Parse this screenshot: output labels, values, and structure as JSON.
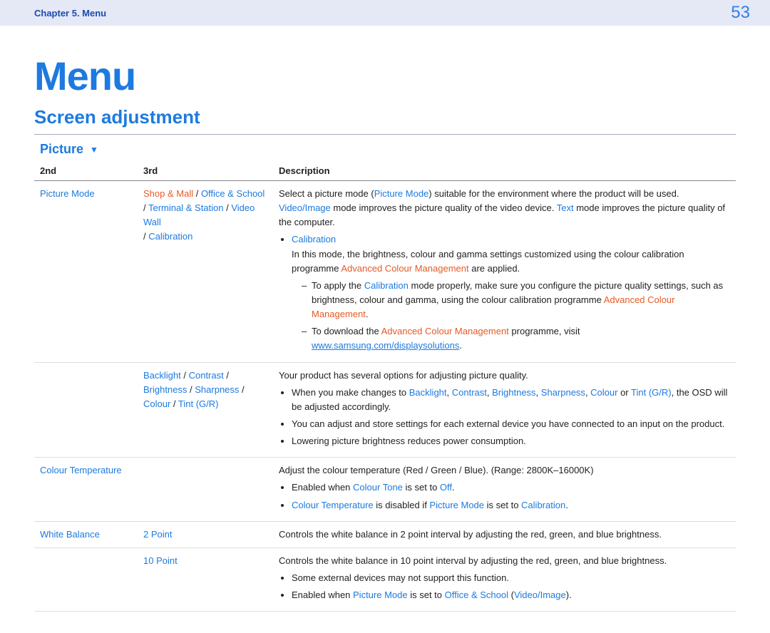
{
  "header": {
    "chapter": "Chapter 5. Menu",
    "page_number": "53"
  },
  "title": "Menu",
  "section": "Screen adjustment",
  "group": "Picture",
  "columns": {
    "c1": "2nd",
    "c2": "3rd",
    "c3": "Description"
  },
  "rows": {
    "picture_mode": {
      "label": "Picture Mode",
      "opts": {
        "a": "Shop & Mall",
        "b": "Office & School",
        "c": "Terminal & Station",
        "d": "Video Wall",
        "e": "Calibration"
      },
      "desc": {
        "t1a": "Select a picture mode (",
        "t1b": "Picture Mode",
        "t1c": ") suitable for the environment where the product will be used.",
        "t2a": "Video/Image",
        "t2b": " mode improves the picture quality of the video device. ",
        "t2c": "Text",
        "t2d": " mode improves the picture quality of the computer.",
        "cal_head": "Calibration",
        "cal_t1": "In this mode, the brightness, colour and gamma settings customized using the colour calibration programme ",
        "cal_t2": "Advanced Colour Management",
        "cal_t3": " are applied.",
        "d1a": "To apply the ",
        "d1b": "Calibration",
        "d1c": " mode properly, make sure you configure the picture quality settings, such as brightness, colour and gamma, using the colour calibration programme ",
        "d1d": "Advanced Colour Management",
        "d1e": ".",
        "d2a": "To download the ",
        "d2b": "Advanced Colour Management",
        "d2c": " programme, visit ",
        "d2d": "www.samsung.com/displaysolutions",
        "d2e": "."
      }
    },
    "backlight": {
      "opts": {
        "a": "Backlight",
        "b": "Contrast",
        "c": "Brightness",
        "d": "Sharpness",
        "e": "Colour",
        "f": "Tint (G/R)"
      },
      "desc": {
        "t1": "Your product has several options for adjusting picture quality.",
        "b1a": "When you make changes to ",
        "b1b": "Backlight",
        "b1c": "Contrast",
        "b1d": "Brightness",
        "b1e": "Sharpness",
        "b1f": "Colour",
        "b1g": "Tint (G/R)",
        "b1h": ", the OSD will be adjusted accordingly.",
        "b2": "You can adjust and store settings for each external device you have connected to an input on the product.",
        "b3": "Lowering picture brightness reduces power consumption."
      }
    },
    "colour_temp": {
      "label": "Colour Temperature",
      "desc": {
        "t1": "Adjust the colour temperature (Red / Green / Blue). (Range: 2800K–16000K)",
        "b1a": "Enabled when ",
        "b1b": "Colour Tone",
        "b1c": " is set to ",
        "b1d": "Off",
        "b1e": ".",
        "b2a": "Colour Temperature",
        "b2b": " is disabled if ",
        "b2c": "Picture Mode",
        "b2d": " is set to ",
        "b2e": "Calibration",
        "b2f": "."
      }
    },
    "white_balance": {
      "label": "White Balance",
      "two_point": "2 Point",
      "ten_point": "10 Point",
      "desc": {
        "t1": "Controls the white balance in 2 point interval by adjusting the red, green, and blue brightness.",
        "t2": "Controls the white balance in 10 point interval by adjusting the red, green, and blue brightness.",
        "b1": "Some external devices may not support this function.",
        "b2a": "Enabled when ",
        "b2b": "Picture Mode",
        "b2c": " is set to ",
        "b2d": "Office & School",
        "b2e": " (",
        "b2f": "Video/Image",
        "b2g": ")."
      }
    }
  }
}
